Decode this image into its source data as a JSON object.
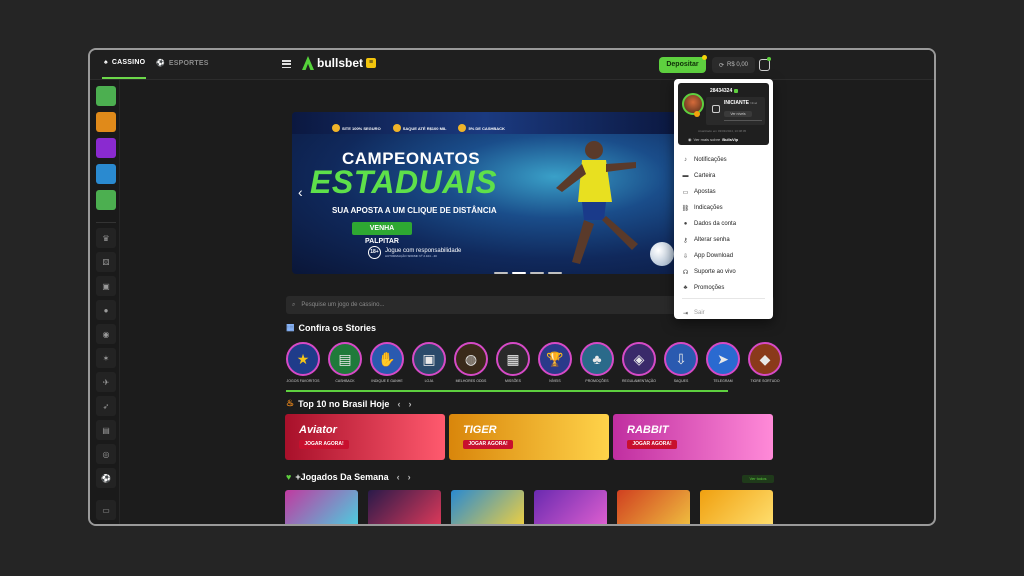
{
  "header": {
    "tabs": [
      {
        "label": "CASSINO",
        "active": true,
        "icon": "casino-icon"
      },
      {
        "label": "ESPORTES",
        "active": false,
        "icon": "soccer-ball-icon"
      }
    ],
    "brand": "bullsbet",
    "deposit_label": "Depositar",
    "balance": "R$ 0,00"
  },
  "banner": {
    "badges": [
      "SITE 100% SEGURO",
      "SAQUE ATÉ R$100 MIL",
      "5% DE CASHBACK"
    ],
    "title1": "CAMPEONATOS",
    "title2": "ESTADUAIS",
    "subtitle": "SUA APOSTA A UM CLIQUE DE DISTÂNCIA",
    "cta": "VENHA PALPITAR",
    "age": "18+",
    "responsible": "Jogue com responsabilidade",
    "authorization": "AUTORIZAÇÃO SPA/MF Nº 2.104 - 40"
  },
  "search": {
    "placeholder": "Pesquise um jogo de cassino..."
  },
  "stories": {
    "title": "Confira os Stories",
    "items": [
      {
        "label": "JOGOS FAVORITOS",
        "icon": "star-icon"
      },
      {
        "label": "CASHBACK",
        "icon": "cash-icon"
      },
      {
        "label": "INDIQUE E GANHE",
        "icon": "money-hand-icon"
      },
      {
        "label": "LOJA",
        "icon": "store-icon"
      },
      {
        "label": "MELHORES ODDS",
        "icon": "stadium-icon"
      },
      {
        "label": "MISSÕES",
        "icon": "missions-icon"
      },
      {
        "label": "NÍVEIS",
        "icon": "trophy-icon"
      },
      {
        "label": "PROMOÇÕES",
        "icon": "gift-icon"
      },
      {
        "label": "REGULAMENTAÇÃO",
        "icon": "regulation-icon"
      },
      {
        "label": "SAQUES",
        "icon": "withdraw-icon"
      },
      {
        "label": "TELEGRAM",
        "icon": "telegram-icon"
      },
      {
        "label": "TIGRE SORTUDO",
        "icon": "tiger-icon"
      }
    ]
  },
  "top10": {
    "title": "Top 10 no Brasil Hoje",
    "cards": [
      {
        "title": "Aviator",
        "button": "JOGAR AGORA!",
        "color_from": "#a8102a",
        "color_to": "#ff5a6e"
      },
      {
        "title": "TIGER",
        "button": "JOGAR AGORA!",
        "color_from": "#d9860b",
        "color_to": "#ffd34a"
      },
      {
        "title": "RABBIT",
        "button": "JOGAR AGORA!",
        "color_from": "#c02ea0",
        "color_to": "#ff8ad8"
      }
    ]
  },
  "weekly": {
    "title": "+Jogados Da Semana",
    "see_all": "Ver todos",
    "cards": [
      {
        "color_from": "#c03aa0",
        "color_to": "#4ad0e0"
      },
      {
        "color_from": "#2a1a4a",
        "color_to": "#e03a5a"
      },
      {
        "color_from": "#2a8ad0",
        "color_to": "#f0d040"
      },
      {
        "color_from": "#6a2ab0",
        "color_to": "#e060d0"
      },
      {
        "color_from": "#d04020",
        "color_to": "#f0c040"
      },
      {
        "color_from": "#f0a010",
        "color_to": "#ffe070"
      }
    ]
  },
  "dropdown": {
    "user_id": "28434324",
    "level": "INICIANTE",
    "level_suffix": "Nível",
    "see_levels": "Ver níveis",
    "updated": "Atualizado em 03/03/2024, 10:08:05",
    "vip_prefix": "Ver mais sobre",
    "vip_name": "BullsVip",
    "items": [
      {
        "label": "Notificações",
        "icon": "bell-icon"
      },
      {
        "label": "Carteira",
        "icon": "wallet-icon"
      },
      {
        "label": "Apostas",
        "icon": "ticket-icon"
      },
      {
        "label": "Indicações",
        "icon": "link-icon"
      },
      {
        "label": "Dados da conta",
        "icon": "user-icon"
      },
      {
        "label": "Alterar senha",
        "icon": "key-icon"
      },
      {
        "label": "App Download",
        "icon": "download-icon"
      },
      {
        "label": "Suporte ao vivo",
        "icon": "support-icon"
      },
      {
        "label": "Promoções",
        "icon": "gift-icon"
      }
    ],
    "logout": "Sair"
  },
  "colors": {
    "accent": "#5ed03f",
    "background": "#1c1c1c",
    "story_ring": "#d64ac6"
  }
}
